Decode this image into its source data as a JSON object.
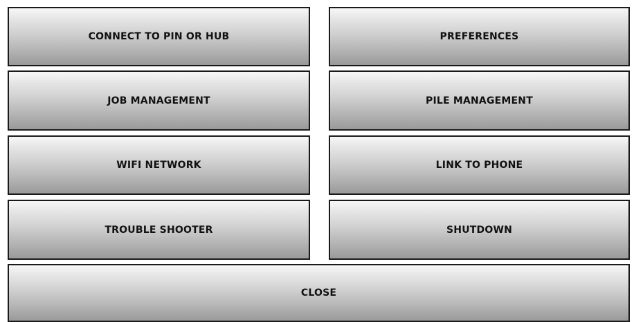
{
  "menu": {
    "connect": "CONNECT TO PIN OR HUB",
    "preferences": "PREFERENCES",
    "job_management": "JOB MANAGEMENT",
    "pile_management": "PILE MANAGEMENT",
    "wifi_network": "WIFI NETWORK",
    "link_to_phone": "LINK TO PHONE",
    "trouble_shooter": "TROUBLE SHOOTER",
    "shutdown": "SHUTDOWN",
    "close": "CLOSE"
  }
}
